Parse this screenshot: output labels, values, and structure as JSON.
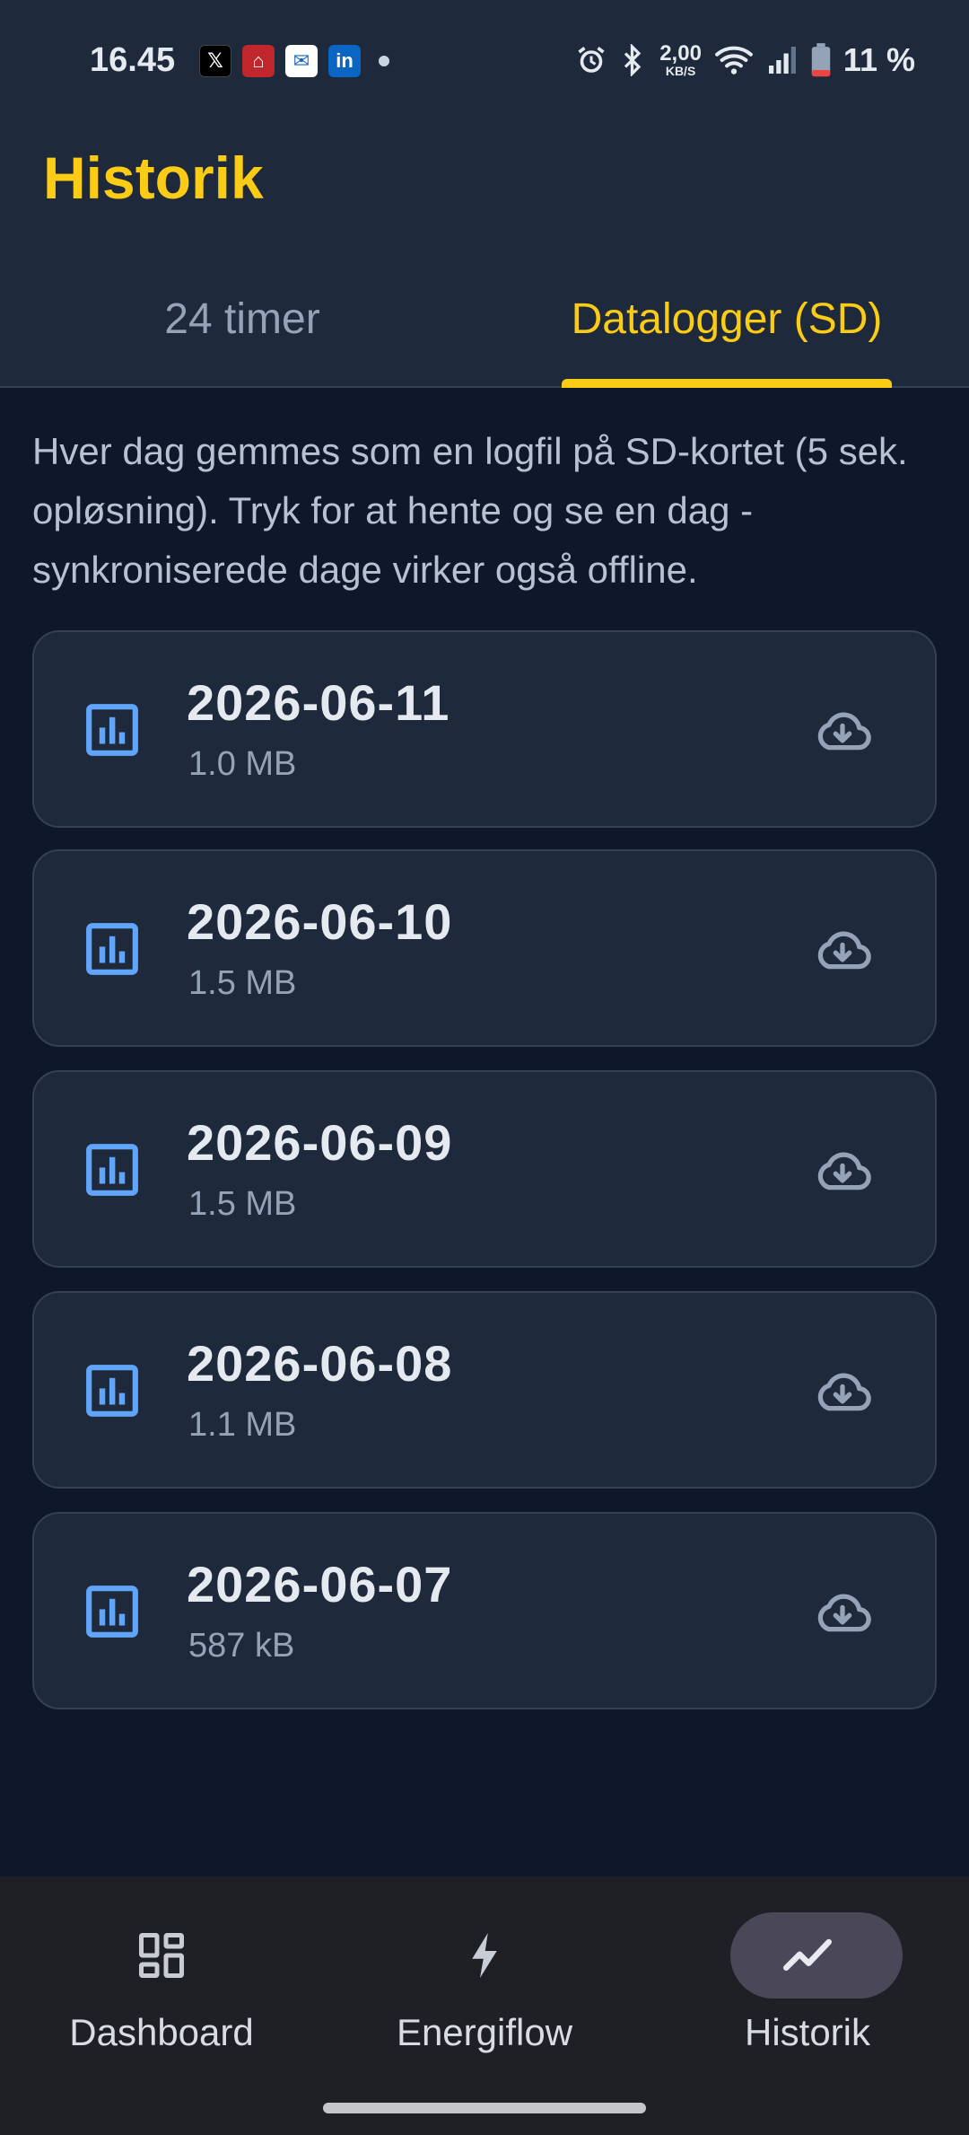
{
  "status_bar": {
    "time": "16.45",
    "net_speed_value": "2,00",
    "net_speed_unit": "KB/S",
    "battery": "11 %"
  },
  "header": {
    "title": "Historik"
  },
  "tabs": [
    {
      "label": "24 timer",
      "active": false
    },
    {
      "label": "Datalogger (SD)",
      "active": true
    }
  ],
  "intro_text": "Hver dag gemmes som en logfil på SD-kortet (5 sek. opløsning). Tryk for at hente og se en dag - synkroniserede dage virker også offline.",
  "log_files": [
    {
      "date": "2026-06-11",
      "size": "1.0 MB"
    },
    {
      "date": "2026-06-10",
      "size": "1.5 MB"
    },
    {
      "date": "2026-06-09",
      "size": "1.5 MB"
    },
    {
      "date": "2026-06-08",
      "size": "1.1 MB"
    },
    {
      "date": "2026-06-07",
      "size": "587 kB"
    }
  ],
  "bottom_nav": [
    {
      "label": "Dashboard",
      "icon": "dashboard-icon",
      "active": false
    },
    {
      "label": "Energiflow",
      "icon": "bolt-icon",
      "active": false
    },
    {
      "label": "Historik",
      "icon": "trending-icon",
      "active": true
    }
  ],
  "colors": {
    "accent": "#facc15",
    "background": "#0f172a",
    "surface": "#1e293b",
    "chart_icon": "#60a5fa"
  }
}
